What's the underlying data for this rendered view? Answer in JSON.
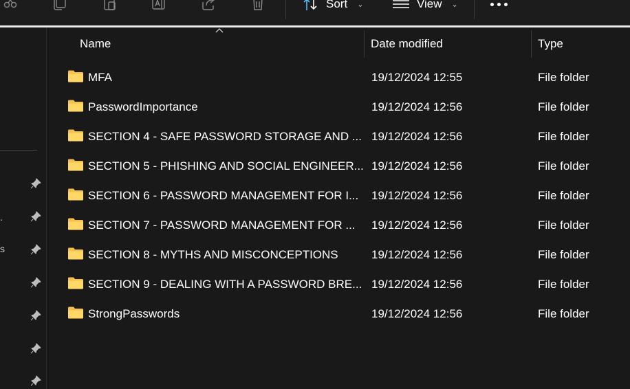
{
  "toolbar": {
    "icons": [
      "cut-icon",
      "copy-icon",
      "paste-icon",
      "rename-icon",
      "share-icon",
      "delete-icon"
    ],
    "sort_label": "Sort",
    "view_label": "View",
    "more_icon": "more-icon"
  },
  "columns": {
    "name": "Name",
    "date": "Date modified",
    "type": "Type"
  },
  "files": [
    {
      "name": "MFA",
      "date": "19/12/2024 12:55",
      "type": "File folder"
    },
    {
      "name": "PasswordImportance",
      "date": "19/12/2024 12:56",
      "type": "File folder"
    },
    {
      "name": "SECTION 4 - SAFE PASSWORD STORAGE AND ...",
      "date": "19/12/2024 12:56",
      "type": "File folder"
    },
    {
      "name": "SECTION 5 - PHISHING AND SOCIAL ENGINEER...",
      "date": "19/12/2024 12:56",
      "type": "File folder"
    },
    {
      "name": "SECTION 6 - PASSWORD MANAGEMENT FOR I...",
      "date": "19/12/2024 12:56",
      "type": "File folder"
    },
    {
      "name": "SECTION 7 - PASSWORD MANAGEMENT FOR ...",
      "date": "19/12/2024 12:56",
      "type": "File folder"
    },
    {
      "name": "SECTION 8 - MYTHS AND MISCONCEPTIONS",
      "date": "19/12/2024 12:56",
      "type": "File folder"
    },
    {
      "name": "SECTION 9 - DEALING WITH A PASSWORD BRE...",
      "date": "19/12/2024 12:56",
      "type": "File folder"
    },
    {
      "name": "StrongPasswords",
      "date": "19/12/2024 12:56",
      "type": "File folder"
    }
  ],
  "nav": {
    "pin_icon": "pin-icon",
    "fragments": [
      ".",
      "s"
    ]
  },
  "colors": {
    "background": "#191919",
    "folder": "#f4c14e",
    "accent_sort": "#4cc2ff"
  }
}
